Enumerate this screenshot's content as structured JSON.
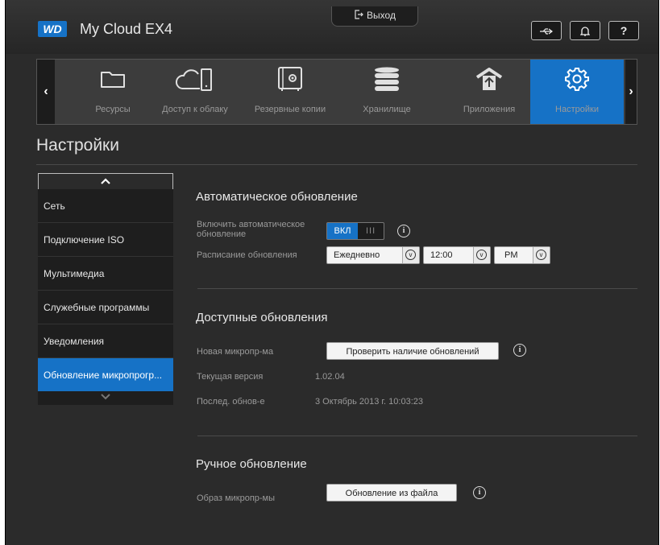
{
  "header": {
    "logo": "WD",
    "app_title": "My Cloud EX4",
    "logout_label": "Выход",
    "usb_icon": "usb-icon",
    "bell_icon": "bell-icon",
    "help_label": "?"
  },
  "nav": {
    "prev": "‹",
    "next": "›",
    "items": [
      {
        "label": "Ресурсы",
        "icon": "folder-icon"
      },
      {
        "label": "Доступ к облаку",
        "icon": "cloud-device-icon"
      },
      {
        "label": "Резервные копии",
        "icon": "safe-icon"
      },
      {
        "label": "Хранилище",
        "icon": "storage-stack-icon"
      },
      {
        "label": "Приложения",
        "icon": "apps-upload-icon"
      },
      {
        "label": "Настройки",
        "icon": "gear-icon"
      }
    ],
    "active_index": 5
  },
  "page_title": "Настройки",
  "sidebar": {
    "up": "^",
    "down": "v",
    "items": [
      {
        "label": "Сеть"
      },
      {
        "label": "Подключение ISO"
      },
      {
        "label": "Мультимедиа"
      },
      {
        "label": "Служебные программы"
      },
      {
        "label": "Уведомления"
      },
      {
        "label": "Обновление микропрогр..."
      }
    ]
  },
  "auto_update": {
    "title": "Автоматическое обновление",
    "enable_label_line1": "Включить автоматическое",
    "enable_label_line2": "обновление",
    "toggle_value": "ВКЛ",
    "toggle_grip": "III",
    "schedule_label": "Расписание обновления",
    "schedule_frequency": "Ежедневно",
    "schedule_time": "12:00",
    "schedule_ampm": "PM"
  },
  "available_updates": {
    "title": "Доступные обновления",
    "new_firmware_label": "Новая микропр-ма",
    "check_button": "Проверить наличие обновлений",
    "current_version_label": "Текущая версия",
    "current_version_value": "1.02.04",
    "last_update_label": "Послед. обнов-е",
    "last_update_value": "3 Октябрь 2013 г. 10:03:23"
  },
  "manual_update": {
    "title": "Ручное обновление",
    "image_label": "Образ микропр-мы",
    "file_button": "Обновление из файла"
  },
  "info_glyph": "i",
  "dropdown_glyph": "v"
}
